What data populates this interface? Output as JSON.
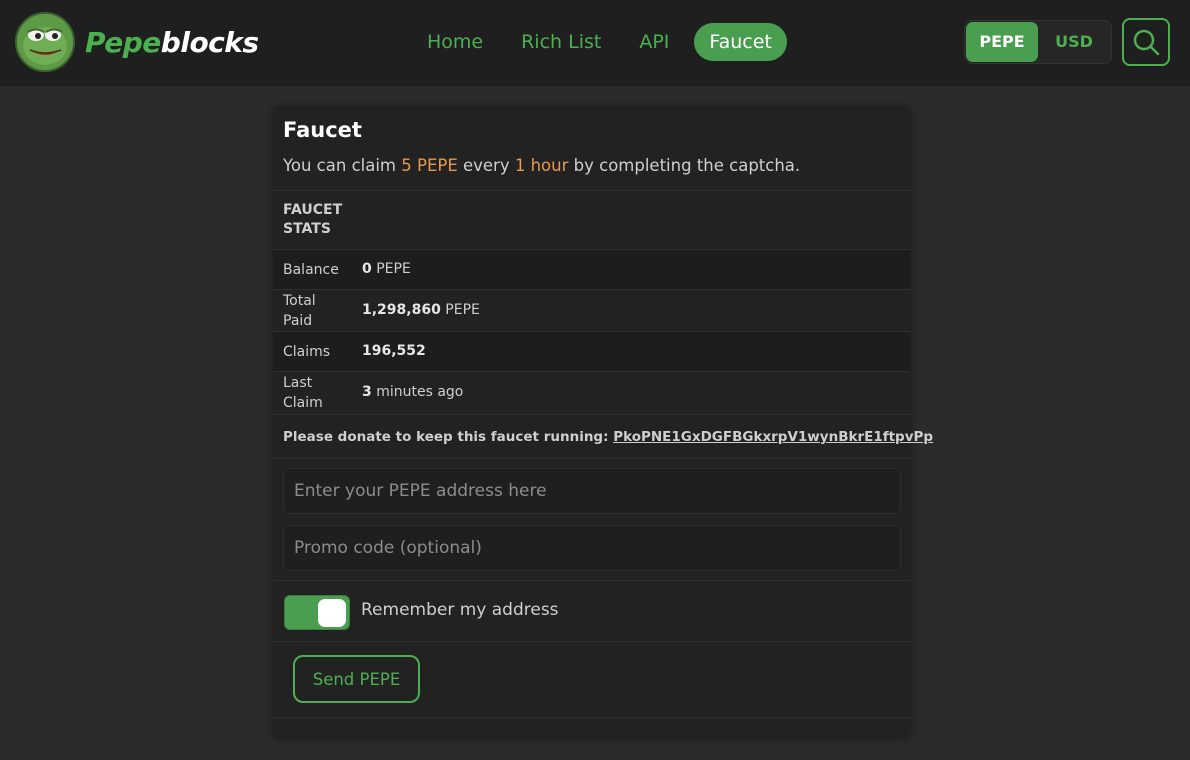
{
  "brand": {
    "name_part1": "Pepe",
    "name_part2": "blocks"
  },
  "nav": [
    {
      "label": "Home",
      "active": false
    },
    {
      "label": "Rich List",
      "active": false
    },
    {
      "label": "API",
      "active": false
    },
    {
      "label": "Faucet",
      "active": true
    }
  ],
  "currency": {
    "options": [
      "PEPE",
      "USD"
    ],
    "selected": "PEPE"
  },
  "faucet": {
    "title": "Faucet",
    "sub_prefix": "You can claim ",
    "amount": "5 PEPE",
    "sub_mid": " every ",
    "interval": "1 hour",
    "sub_suffix": " by completing the captcha.",
    "stats_heading_1": "FAUCET",
    "stats_heading_2": "STATS",
    "stats": {
      "balance_label": "Balance",
      "balance_value": "0",
      "balance_unit": " PEPE",
      "total_label_1": "Total",
      "total_label_2": "Paid",
      "total_value": "1,298,860",
      "total_unit": " PEPE",
      "claims_label": "Claims",
      "claims_value": "196,552",
      "last_label_1": "Last",
      "last_label_2": "Claim",
      "last_value": "3",
      "last_unit": " minutes ago"
    },
    "donate_text": "Please donate to keep this faucet running: ",
    "donate_address": "PkoPNE1GxDGFBGkxrpV1wynBkrE1ftpvPp",
    "address_placeholder": "Enter your PEPE address here",
    "promo_placeholder": "Promo code (optional)",
    "remember_label": "Remember my address",
    "remember_on": true,
    "send_label": "Send PEPE"
  },
  "colors": {
    "accent": "#4caf50",
    "highlight": "#e39a4e",
    "bg": "#2b2b2b",
    "header": "#1f1f1f",
    "card": "#222222"
  }
}
